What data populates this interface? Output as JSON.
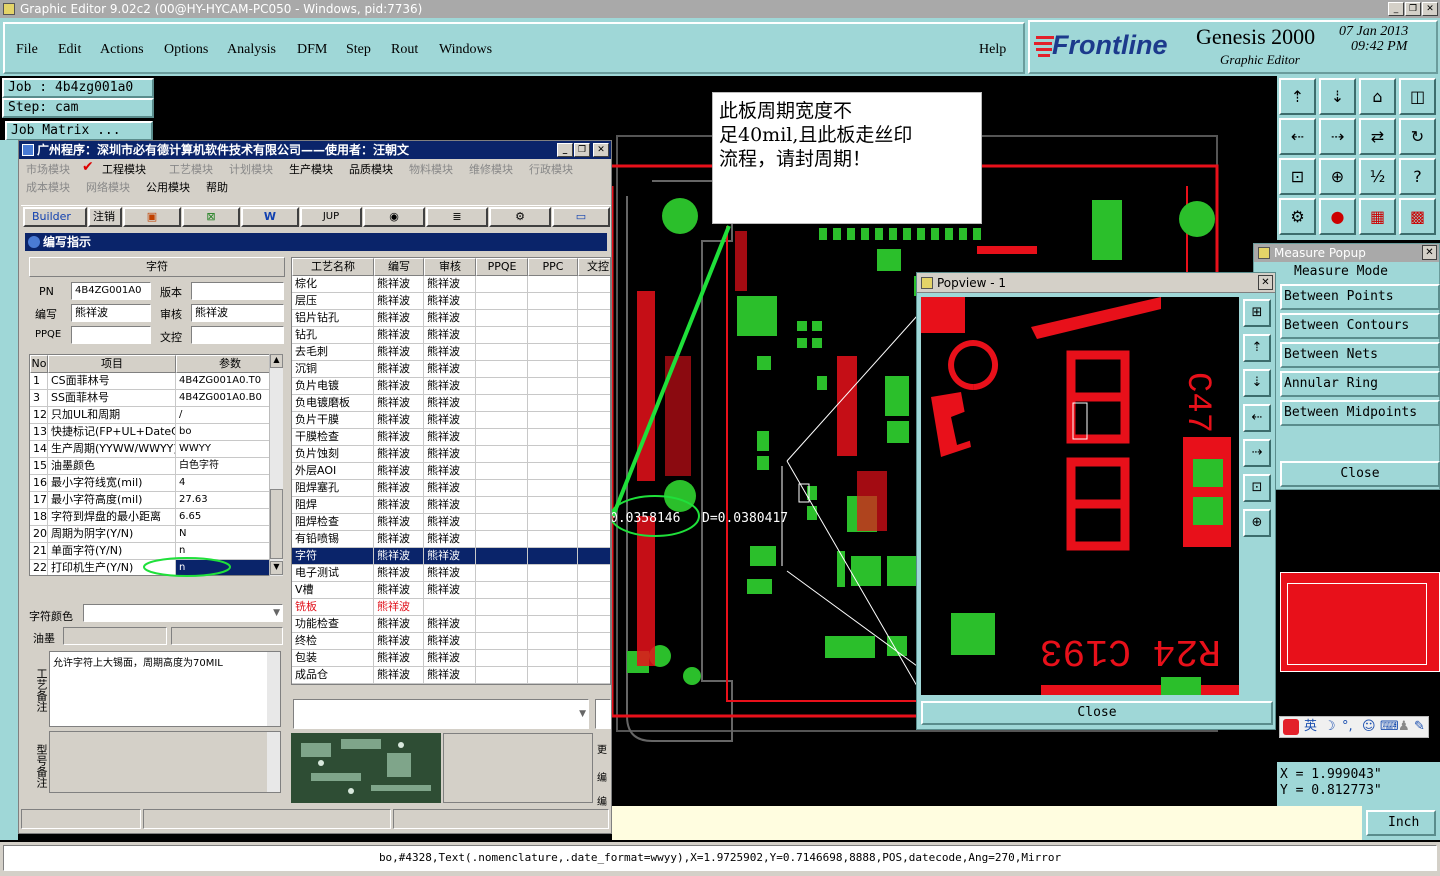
{
  "window": {
    "title": "Graphic Editor 9.02c2 (00@HY-HYCAM-PC050 - Windows, pid:7736)"
  },
  "menu": [
    "File",
    "Edit",
    "Actions",
    "Options",
    "Analysis",
    "DFM",
    "Step",
    "Rout",
    "Windows"
  ],
  "help_label": "Help",
  "brand": {
    "logo": "Frontline",
    "product": "Genesis 2000",
    "subtitle": "Graphic Editor",
    "date": "07 Jan 2013",
    "time": "09:42 PM"
  },
  "job": {
    "job_label": "Job : 4b4zg001a0",
    "step_label": "Step: cam",
    "matrix_label": "Job Matrix ..."
  },
  "annotation": {
    "line1": "此板周期宽度不",
    "line2": "足40mil,且此板走丝印",
    "line3": "流程，请封周期！"
  },
  "measure_readout": {
    "left": "0.0358146",
    "right": "D=0.0380417"
  },
  "measure_popup": {
    "title": "Measure Popup",
    "mode": "Measure Mode",
    "items": [
      "Between Points",
      "Between Contours",
      "Between Nets",
      "Annular Ring",
      "Between Midpoints"
    ],
    "close": "Close"
  },
  "popview": {
    "title": "Popview - 1",
    "close": "Close",
    "labels": {
      "c47": "C47",
      "r24": "R24",
      "c193": "C193"
    }
  },
  "coords": {
    "x": "X = 1.999043\"",
    "y": "Y = 0.812773\""
  },
  "units": "Inch",
  "ime": {
    "label": "英"
  },
  "status_line": "bo,#4328,Text(.nomenclature,.date_format=wwyy),X=1.9725902,Y=0.7146698,8888,POS,datecode,Ang=270,Mirror",
  "app": {
    "title": "广州程序：深圳市必有德计算机软件技术有限公司——使用者：汪朝文",
    "menu_row1": [
      {
        "label": "市场模块",
        "enabled": false
      },
      {
        "label": "工程模块",
        "enabled": true,
        "checked": true
      },
      {
        "label": "工艺模块",
        "enabled": false
      },
      {
        "label": "计划模块",
        "enabled": false
      },
      {
        "label": "生产模块",
        "enabled": true
      },
      {
        "label": "品质模块",
        "enabled": true
      },
      {
        "label": "物料模块",
        "enabled": false
      },
      {
        "label": "维修模块",
        "enabled": false
      },
      {
        "label": "行政模块",
        "enabled": false
      }
    ],
    "menu_row2": [
      {
        "label": "成本模块",
        "enabled": false
      },
      {
        "label": "网络模块",
        "enabled": false
      },
      {
        "label": "公用模块",
        "enabled": true
      },
      {
        "label": "帮助",
        "enabled": true
      }
    ],
    "toolbar": {
      "builder": "Builder",
      "logout": "注销",
      "jup": "JUP"
    },
    "panel_title": "编写指示",
    "group_title": "字符",
    "form": {
      "pn_label": "PN",
      "pn_value": "4B4ZG001A0",
      "version_label": "版本",
      "version_value": "",
      "writer_label": "编写",
      "writer_value": "熊祥波",
      "reviewer_label": "审核",
      "reviewer_value": "熊祥波",
      "ppqe_label": "PPQE",
      "ppqe_value": "",
      "doc_label": "文控",
      "doc_value": ""
    },
    "params": {
      "headers": [
        "No",
        "项目",
        "参数"
      ],
      "rows": [
        [
          "1",
          "CS面菲林号",
          "4B4ZG001A0.T0"
        ],
        [
          "3",
          "SS面菲林号",
          "4B4ZG001A0.B0"
        ],
        [
          "12",
          "只加UL和周期",
          "/"
        ],
        [
          "13",
          "快捷标记(FP+UL+DateCo",
          "bo"
        ],
        [
          "14",
          "生产周期(YYWW/WWYY)",
          "WWYY"
        ],
        [
          "15",
          "油墨颜色",
          "白色字符"
        ],
        [
          "16",
          "最小字符线宽(mil)",
          "4"
        ],
        [
          "17",
          "最小字符高度(mil)",
          "27.63"
        ],
        [
          "18",
          "字符到焊盘的最小距离",
          "6.65"
        ],
        [
          "20",
          "周期为阴字(Y/N)",
          "N"
        ],
        [
          "21",
          "单面字符(Y/N)",
          "n"
        ],
        [
          "22",
          "打印机生产(Y/N)",
          "n"
        ]
      ]
    },
    "char_color_label": "字符颜色",
    "ink_label": "油墨",
    "notes_label": "工艺备注",
    "notes_text": "允许字符上大锡面，周期高度为70MIL",
    "model_notes_label": "型号备注",
    "process": {
      "headers": [
        "工艺名称",
        "编写",
        "审核",
        "PPQE",
        "PPC",
        "文控"
      ],
      "rows": [
        [
          "棕化",
          "熊祥波",
          "熊祥波"
        ],
        [
          "层压",
          "熊祥波",
          "熊祥波"
        ],
        [
          "铝片钻孔",
          "熊祥波",
          "熊祥波"
        ],
        [
          "钻孔",
          "熊祥波",
          "熊祥波"
        ],
        [
          "去毛刺",
          "熊祥波",
          "熊祥波"
        ],
        [
          "沉铜",
          "熊祥波",
          "熊祥波"
        ],
        [
          "负片电镀",
          "熊祥波",
          "熊祥波"
        ],
        [
          "负电镀磨板",
          "熊祥波",
          "熊祥波"
        ],
        [
          "负片干膜",
          "熊祥波",
          "熊祥波"
        ],
        [
          "干膜检查",
          "熊祥波",
          "熊祥波"
        ],
        [
          "负片蚀刻",
          "熊祥波",
          "熊祥波"
        ],
        [
          "外层AOI",
          "熊祥波",
          "熊祥波"
        ],
        [
          "阻焊塞孔",
          "熊祥波",
          "熊祥波"
        ],
        [
          "阻焊",
          "熊祥波",
          "熊祥波"
        ],
        [
          "阻焊检查",
          "熊祥波",
          "熊祥波"
        ],
        [
          "有铅喷锡",
          "熊祥波",
          "熊祥波"
        ],
        [
          "字符",
          "熊祥波",
          "熊祥波"
        ],
        [
          "电子测试",
          "熊祥波",
          "熊祥波"
        ],
        [
          "V槽",
          "熊祥波",
          "熊祥波"
        ],
        [
          "铣板",
          "熊祥波",
          ""
        ],
        [
          "功能检查",
          "熊祥波",
          "熊祥波"
        ],
        [
          "终检",
          "熊祥波",
          "熊祥波"
        ],
        [
          "包装",
          "熊祥波",
          "熊祥波"
        ],
        [
          "成品仓",
          "熊祥波",
          "熊祥波"
        ]
      ],
      "selected_index": 16,
      "red_index": 19
    },
    "side_labels": {
      "a": "更",
      "b": "编",
      "c": "编"
    }
  },
  "colors": {
    "cyan": "#9fd7d7",
    "copper_red": "#e8101a",
    "pad_green": "#2bbf2b",
    "selection": "#0a246a",
    "logo_red": "#e3202a",
    "logo_blue": "#1c3a8c"
  }
}
